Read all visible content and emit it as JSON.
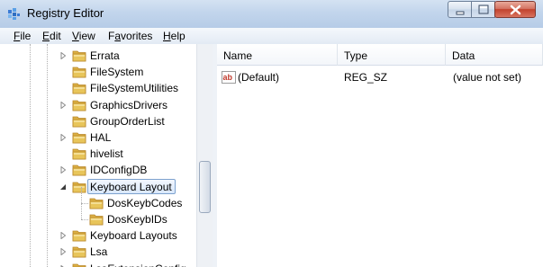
{
  "window": {
    "title": "Registry Editor",
    "buttons": {
      "minimize": "minimize",
      "maximize": "maximize",
      "close": "close"
    }
  },
  "menu": [
    {
      "accel": "F",
      "rest": "ile"
    },
    {
      "accel": "E",
      "rest": "dit"
    },
    {
      "accel": "V",
      "rest": "iew"
    },
    {
      "accel": "",
      "pre": "F",
      "accelMid": "a",
      "rest": "vorites"
    },
    {
      "accel": "H",
      "rest": "elp"
    }
  ],
  "menu_labels": [
    "File",
    "Edit",
    "View",
    "Favorites",
    "Help"
  ],
  "tree": {
    "items": [
      {
        "label": "Errata",
        "expander": "collapsed"
      },
      {
        "label": "FileSystem",
        "expander": "none"
      },
      {
        "label": "FileSystemUtilities",
        "expander": "none"
      },
      {
        "label": "GraphicsDrivers",
        "expander": "collapsed"
      },
      {
        "label": "GroupOrderList",
        "expander": "none"
      },
      {
        "label": "HAL",
        "expander": "collapsed"
      },
      {
        "label": "hivelist",
        "expander": "none"
      },
      {
        "label": "IDConfigDB",
        "expander": "collapsed"
      },
      {
        "label": "Keyboard Layout",
        "expander": "expanded",
        "selected": true
      },
      {
        "label": "DosKeybCodes",
        "expander": "none",
        "child": true
      },
      {
        "label": "DosKeybIDs",
        "expander": "none",
        "child": true
      },
      {
        "label": "Keyboard Layouts",
        "expander": "collapsed"
      },
      {
        "label": "Lsa",
        "expander": "collapsed"
      },
      {
        "label": "LsaExtensionConfig",
        "expander": "collapsed"
      }
    ]
  },
  "list": {
    "columns": [
      "Name",
      "Type",
      "Data"
    ],
    "rows": [
      {
        "name": "(Default)",
        "type": "REG_SZ",
        "data": "(value not set)",
        "icon": "string-value-icon"
      }
    ]
  },
  "colors": {
    "folder": "#e8c55a",
    "selection_border": "#7da2ce",
    "ab_icon": "#c0392b"
  }
}
